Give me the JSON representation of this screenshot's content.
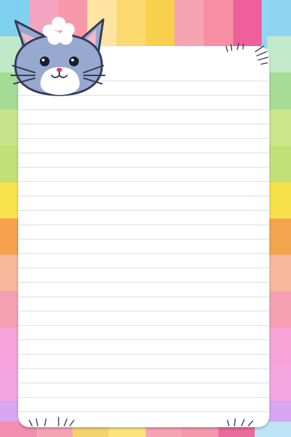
{
  "colors": {
    "top_stripes": [
      "#7fd3ee",
      "#f2a4c0",
      "#f799a9",
      "#fde4a0",
      "#fbd96e",
      "#f8d04b",
      "#f6a3b3",
      "#f98fa3",
      "#ef5f9a",
      "#92d7f1"
    ],
    "left_stripes": [
      "#7fd0ee",
      "#bfe9c8",
      "#a4dc95",
      "#c6e58b",
      "#c1e078",
      "#f7e14c",
      "#f6a14c",
      "#f7b79b",
      "#f59fb2",
      "#f7a2d8",
      "#f2a4e0",
      "#d8a6f2"
    ],
    "right_stripes": [
      "#8dd5f2",
      "#c2eac9",
      "#a7dd95",
      "#cbe68b",
      "#c1e078",
      "#f6e04a",
      "#f5a44e",
      "#f6b89d",
      "#f69fb3",
      "#f7a3d8",
      "#f3a6e0",
      "#d9a7f2"
    ],
    "bottom_stripes": [
      "#f38fb0",
      "#f6a3b3",
      "#f5d36c",
      "#fbe57a",
      "#f6a3b3",
      "#f598ad",
      "#ea6b9d",
      "#bde3f6"
    ],
    "line_color": "#d7dde6",
    "cat_fur": "#97a9cf",
    "cat_outline": "#333b57",
    "ear_inner": "#f7b6c8"
  },
  "icons": {
    "mascot": "cat-face-icon",
    "tuft": "cloud-tuft-icon",
    "scratch": "scratch-marks-icon"
  },
  "paper": {
    "ruled_lines": 24
  }
}
